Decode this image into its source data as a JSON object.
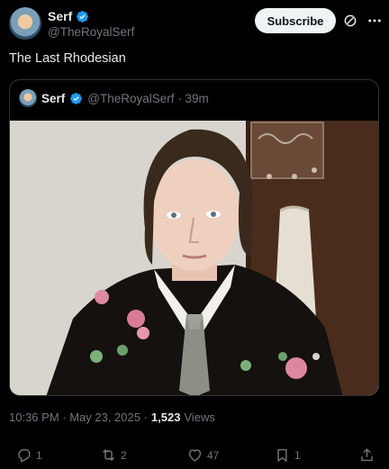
{
  "post": {
    "author_name": "Serf",
    "author_handle": "@TheRoyalSerf",
    "subscribe_label": "Subscribe",
    "text": "The Last Rhodesian",
    "timestamp": "10:36 PM · May 23, 2025 ·",
    "views_count": "1,523",
    "views_label": "Views"
  },
  "quote": {
    "author_name": "Serf",
    "author_handle": "@TheRoyalSerf · 39m"
  },
  "actions": {
    "replies": "1",
    "reposts": "2",
    "likes": "47",
    "bookmarks": "1"
  },
  "colors": {
    "background": "#000000",
    "verified": "#1d9bf0",
    "muted": "#71767b"
  },
  "icons": [
    "verified-badge-icon",
    "grok-icon",
    "more-icon",
    "reply-icon",
    "repost-icon",
    "like-icon",
    "bookmark-icon",
    "share-icon"
  ]
}
